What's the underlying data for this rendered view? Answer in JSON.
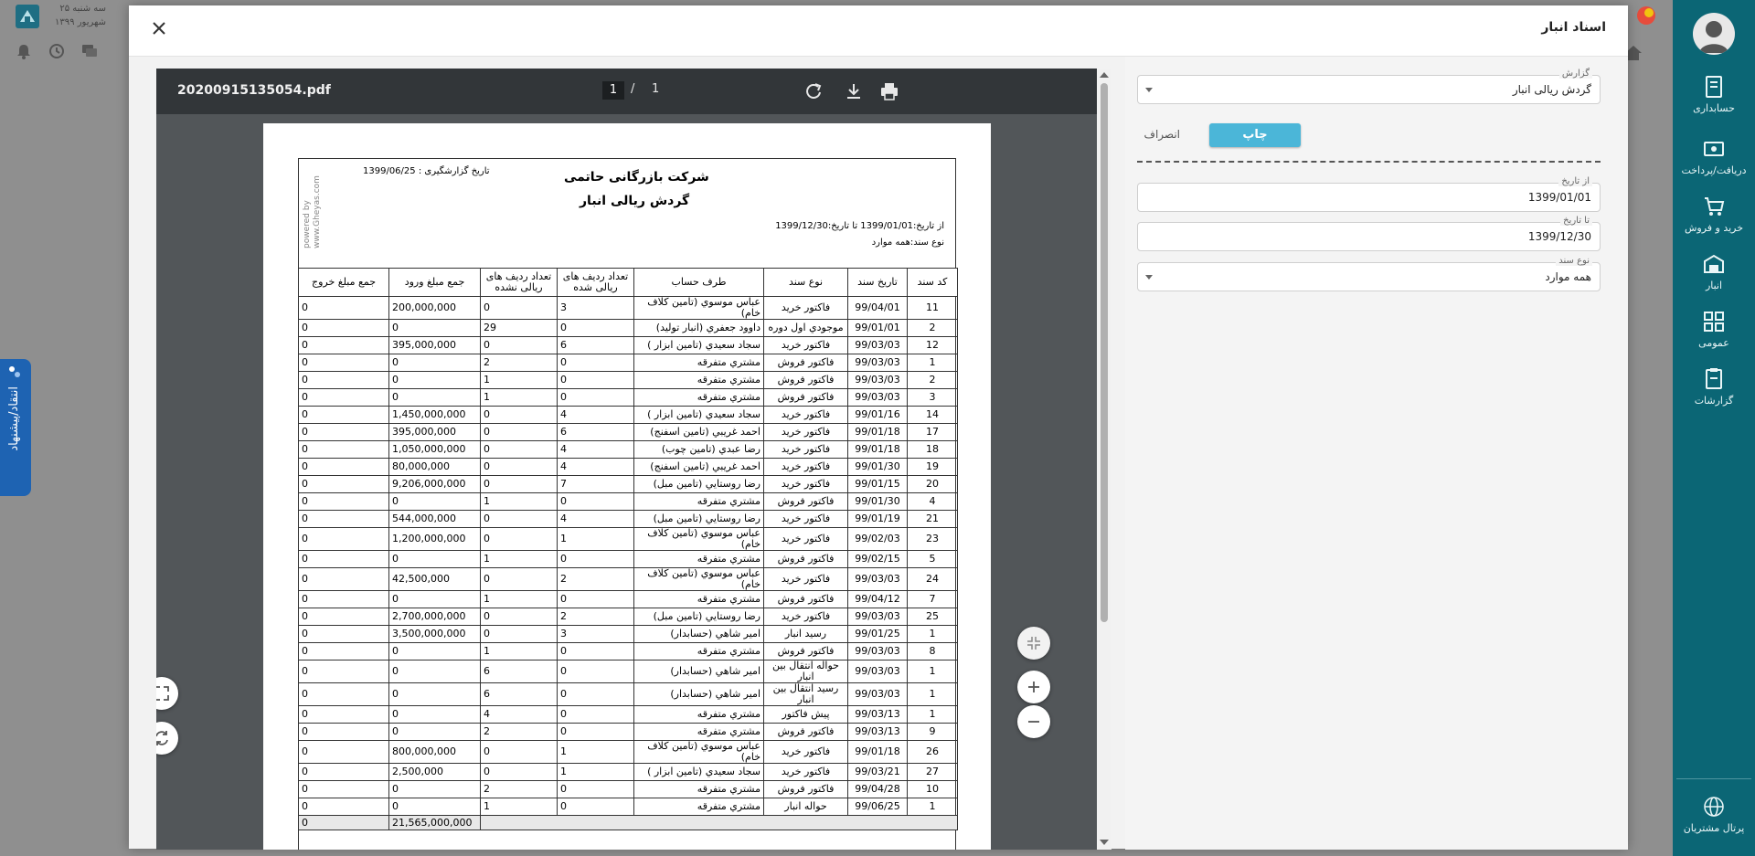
{
  "app": {
    "date_line1": "سه شنبه ۲۵",
    "date_line2": "شهریور ۱۳۹۹",
    "feedback_label": "انتقاد/پیشنهاد"
  },
  "nav": {
    "items": [
      {
        "label": "حسابداری",
        "icon": "accounting-icon"
      },
      {
        "label": "دریافت/پرداخت",
        "icon": "cash-icon"
      },
      {
        "label": "خرید و فروش",
        "icon": "cart-icon"
      },
      {
        "label": "انبار",
        "icon": "warehouse-icon"
      },
      {
        "label": "عمومی",
        "icon": "grid-icon"
      },
      {
        "label": "گزارشات",
        "icon": "reports-icon"
      }
    ],
    "portal_label": "پرتال مشتریان"
  },
  "modal": {
    "title": "اسناد انبار"
  },
  "form": {
    "report": {
      "label": "گزارش",
      "value": "گردش ریالی انبار"
    },
    "print_label": "چاپ",
    "cancel_label": "انصراف",
    "from_date": {
      "label": "از تاریخ",
      "value": "1399/01/01"
    },
    "to_date": {
      "label": "تا تاریخ",
      "value": "1399/12/30"
    },
    "doc_type": {
      "label": "نوع سند",
      "value": "همه موارد"
    }
  },
  "viewer": {
    "file_name": "20200915135054.pdf",
    "current_page": "1",
    "page_separator": "/",
    "total_pages": "1"
  },
  "report": {
    "company": "شرکت بازرگانی حاتمی",
    "title": "گردش ریالی انبار",
    "report_date": "تاریخ گزارشگیری : 1399/06/25",
    "range": "از تاریخ:1399/01/01   تا تاریخ:1399/12/30",
    "doc_type": "نوع سند:همه موارد",
    "powered_by": "powered by",
    "website": "www.Gheyas.com",
    "headers": {
      "code": "کد  سند",
      "date": "تاریخ سند",
      "type": "نوع سند",
      "party": "طرف حساب",
      "priced_rows": "تعداد ردیف های ریالی شده",
      "unpriced_rows": "تعداد ردیف های ریالی نشده",
      "in_total": "جمع مبلغ ورود",
      "out_total": "جمع مبلغ خروج"
    },
    "rows": [
      {
        "code": "11",
        "date": "99/04/01",
        "type": "فاکتور خرید",
        "party": "عباس موسوي (تامين كلاف خام)",
        "priced": "3",
        "unpriced": "0",
        "in": "200,000,000",
        "out": "0",
        "tall": true
      },
      {
        "code": "2",
        "date": "99/01/01",
        "type": "موجودي اول دوره",
        "party": "داوود جعفري (انبار توليد)",
        "priced": "0",
        "unpriced": "29",
        "in": "0",
        "out": "0",
        "tall": false
      },
      {
        "code": "12",
        "date": "99/03/03",
        "type": "فاکتور خرید",
        "party": "سجاد سعيدي (تامين ابزار )",
        "priced": "6",
        "unpriced": "0",
        "in": "395,000,000",
        "out": "0",
        "tall": false
      },
      {
        "code": "1",
        "date": "99/03/03",
        "type": "فاکتور فروش",
        "party": "مشتري متفرقه",
        "priced": "0",
        "unpriced": "2",
        "in": "0",
        "out": "0",
        "tall": false
      },
      {
        "code": "2",
        "date": "99/03/03",
        "type": "فاکتور فروش",
        "party": "مشتري متفرقه",
        "priced": "0",
        "unpriced": "1",
        "in": "0",
        "out": "0",
        "tall": false
      },
      {
        "code": "3",
        "date": "99/03/03",
        "type": "فاکتور فروش",
        "party": "مشتري متفرقه",
        "priced": "0",
        "unpriced": "1",
        "in": "0",
        "out": "0",
        "tall": false
      },
      {
        "code": "14",
        "date": "99/01/16",
        "type": "فاکتور خرید",
        "party": "سجاد سعيدي (تامين ابزار )",
        "priced": "4",
        "unpriced": "0",
        "in": "1,450,000,000",
        "out": "0",
        "tall": false
      },
      {
        "code": "17",
        "date": "99/01/18",
        "type": "فاکتور خرید",
        "party": "احمد غريبي (تامين اسفنج)",
        "priced": "6",
        "unpriced": "0",
        "in": "395,000,000",
        "out": "0",
        "tall": false
      },
      {
        "code": "18",
        "date": "99/01/18",
        "type": "فاکتور خرید",
        "party": "رضا عبدي (تامين چوب)",
        "priced": "4",
        "unpriced": "0",
        "in": "1,050,000,000",
        "out": "0",
        "tall": false
      },
      {
        "code": "19",
        "date": "99/01/30",
        "type": "فاکتور خرید",
        "party": "احمد غريبي (تامين اسفنج)",
        "priced": "4",
        "unpriced": "0",
        "in": "80,000,000",
        "out": "0",
        "tall": false
      },
      {
        "code": "20",
        "date": "99/01/15",
        "type": "فاکتور خرید",
        "party": "رضا روستايي (تامين مبل)",
        "priced": "7",
        "unpriced": "0",
        "in": "9,206,000,000",
        "out": "0",
        "tall": false
      },
      {
        "code": "4",
        "date": "99/01/30",
        "type": "فاکتور فروش",
        "party": "مشتري متفرقه",
        "priced": "0",
        "unpriced": "1",
        "in": "0",
        "out": "0",
        "tall": false
      },
      {
        "code": "21",
        "date": "99/01/19",
        "type": "فاکتور خرید",
        "party": "رضا روستايي (تامين مبل)",
        "priced": "4",
        "unpriced": "0",
        "in": "544,000,000",
        "out": "0",
        "tall": false
      },
      {
        "code": "23",
        "date": "99/02/03",
        "type": "فاکتور خرید",
        "party": "عباس موسوي (تامين كلاف خام)",
        "priced": "1",
        "unpriced": "0",
        "in": "1,200,000,000",
        "out": "0",
        "tall": true
      },
      {
        "code": "5",
        "date": "99/02/15",
        "type": "فاکتور فروش",
        "party": "مشتري متفرقه",
        "priced": "0",
        "unpriced": "1",
        "in": "0",
        "out": "0",
        "tall": false
      },
      {
        "code": "24",
        "date": "99/03/03",
        "type": "فاکتور خرید",
        "party": "عباس موسوي (تامين كلاف خام)",
        "priced": "2",
        "unpriced": "0",
        "in": "42,500,000",
        "out": "0",
        "tall": true
      },
      {
        "code": "7",
        "date": "99/04/12",
        "type": "فاکتور فروش",
        "party": "مشتري متفرقه",
        "priced": "0",
        "unpriced": "1",
        "in": "0",
        "out": "0",
        "tall": false
      },
      {
        "code": "25",
        "date": "99/03/03",
        "type": "فاکتور خرید",
        "party": "رضا روستايي (تامين مبل)",
        "priced": "2",
        "unpriced": "0",
        "in": "2,700,000,000",
        "out": "0",
        "tall": false
      },
      {
        "code": "1",
        "date": "99/01/25",
        "type": "رسید انبار",
        "party": "امير شاهي (حسابدار)",
        "priced": "3",
        "unpriced": "0",
        "in": "3,500,000,000",
        "out": "0",
        "tall": false
      },
      {
        "code": "8",
        "date": "99/03/03",
        "type": "فاکتور فروش",
        "party": "مشتري متفرقه",
        "priced": "0",
        "unpriced": "1",
        "in": "0",
        "out": "0",
        "tall": false
      },
      {
        "code": "1",
        "date": "99/03/03",
        "type": "حواله انتقال بین انبار",
        "party": "امير شاهي (حسابدار)",
        "priced": "0",
        "unpriced": "6",
        "in": "0",
        "out": "0",
        "tall": true
      },
      {
        "code": "1",
        "date": "99/03/03",
        "type": "رسید انتقال بین انبار",
        "party": "امير شاهي (حسابدار)",
        "priced": "0",
        "unpriced": "6",
        "in": "0",
        "out": "0",
        "tall": true
      },
      {
        "code": "1",
        "date": "99/03/13",
        "type": "پیش فاکتور",
        "party": "مشتري متفرقه",
        "priced": "0",
        "unpriced": "4",
        "in": "0",
        "out": "0",
        "tall": false
      },
      {
        "code": "9",
        "date": "99/03/13",
        "type": "فاکتور فروش",
        "party": "مشتري متفرقه",
        "priced": "0",
        "unpriced": "2",
        "in": "0",
        "out": "0",
        "tall": false
      },
      {
        "code": "26",
        "date": "99/01/18",
        "type": "فاکتور خرید",
        "party": "عباس موسوي (تامين كلاف خام)",
        "priced": "1",
        "unpriced": "0",
        "in": "800,000,000",
        "out": "0",
        "tall": true
      },
      {
        "code": "27",
        "date": "99/03/21",
        "type": "فاکتور خرید",
        "party": "سجاد سعيدي (تامين ابزار )",
        "priced": "1",
        "unpriced": "0",
        "in": "2,500,000",
        "out": "0",
        "tall": false
      },
      {
        "code": "10",
        "date": "99/04/28",
        "type": "فاکتور فروش",
        "party": "مشتري متفرقه",
        "priced": "0",
        "unpriced": "2",
        "in": "0",
        "out": "0",
        "tall": false
      },
      {
        "code": "1",
        "date": "99/06/25",
        "type": "حواله انبار",
        "party": "مشتري متفرقه",
        "priced": "0",
        "unpriced": "1",
        "in": "0",
        "out": "0",
        "tall": false
      }
    ],
    "total": {
      "in": "21,565,000,000",
      "out": "0"
    }
  },
  "colors": {
    "nav_bg": "#0b6675",
    "primary_button": "#4bb6d8",
    "feedback_tab": "#1e63b2",
    "viewer_toolbar": "#323639",
    "viewer_bg": "#525659"
  }
}
